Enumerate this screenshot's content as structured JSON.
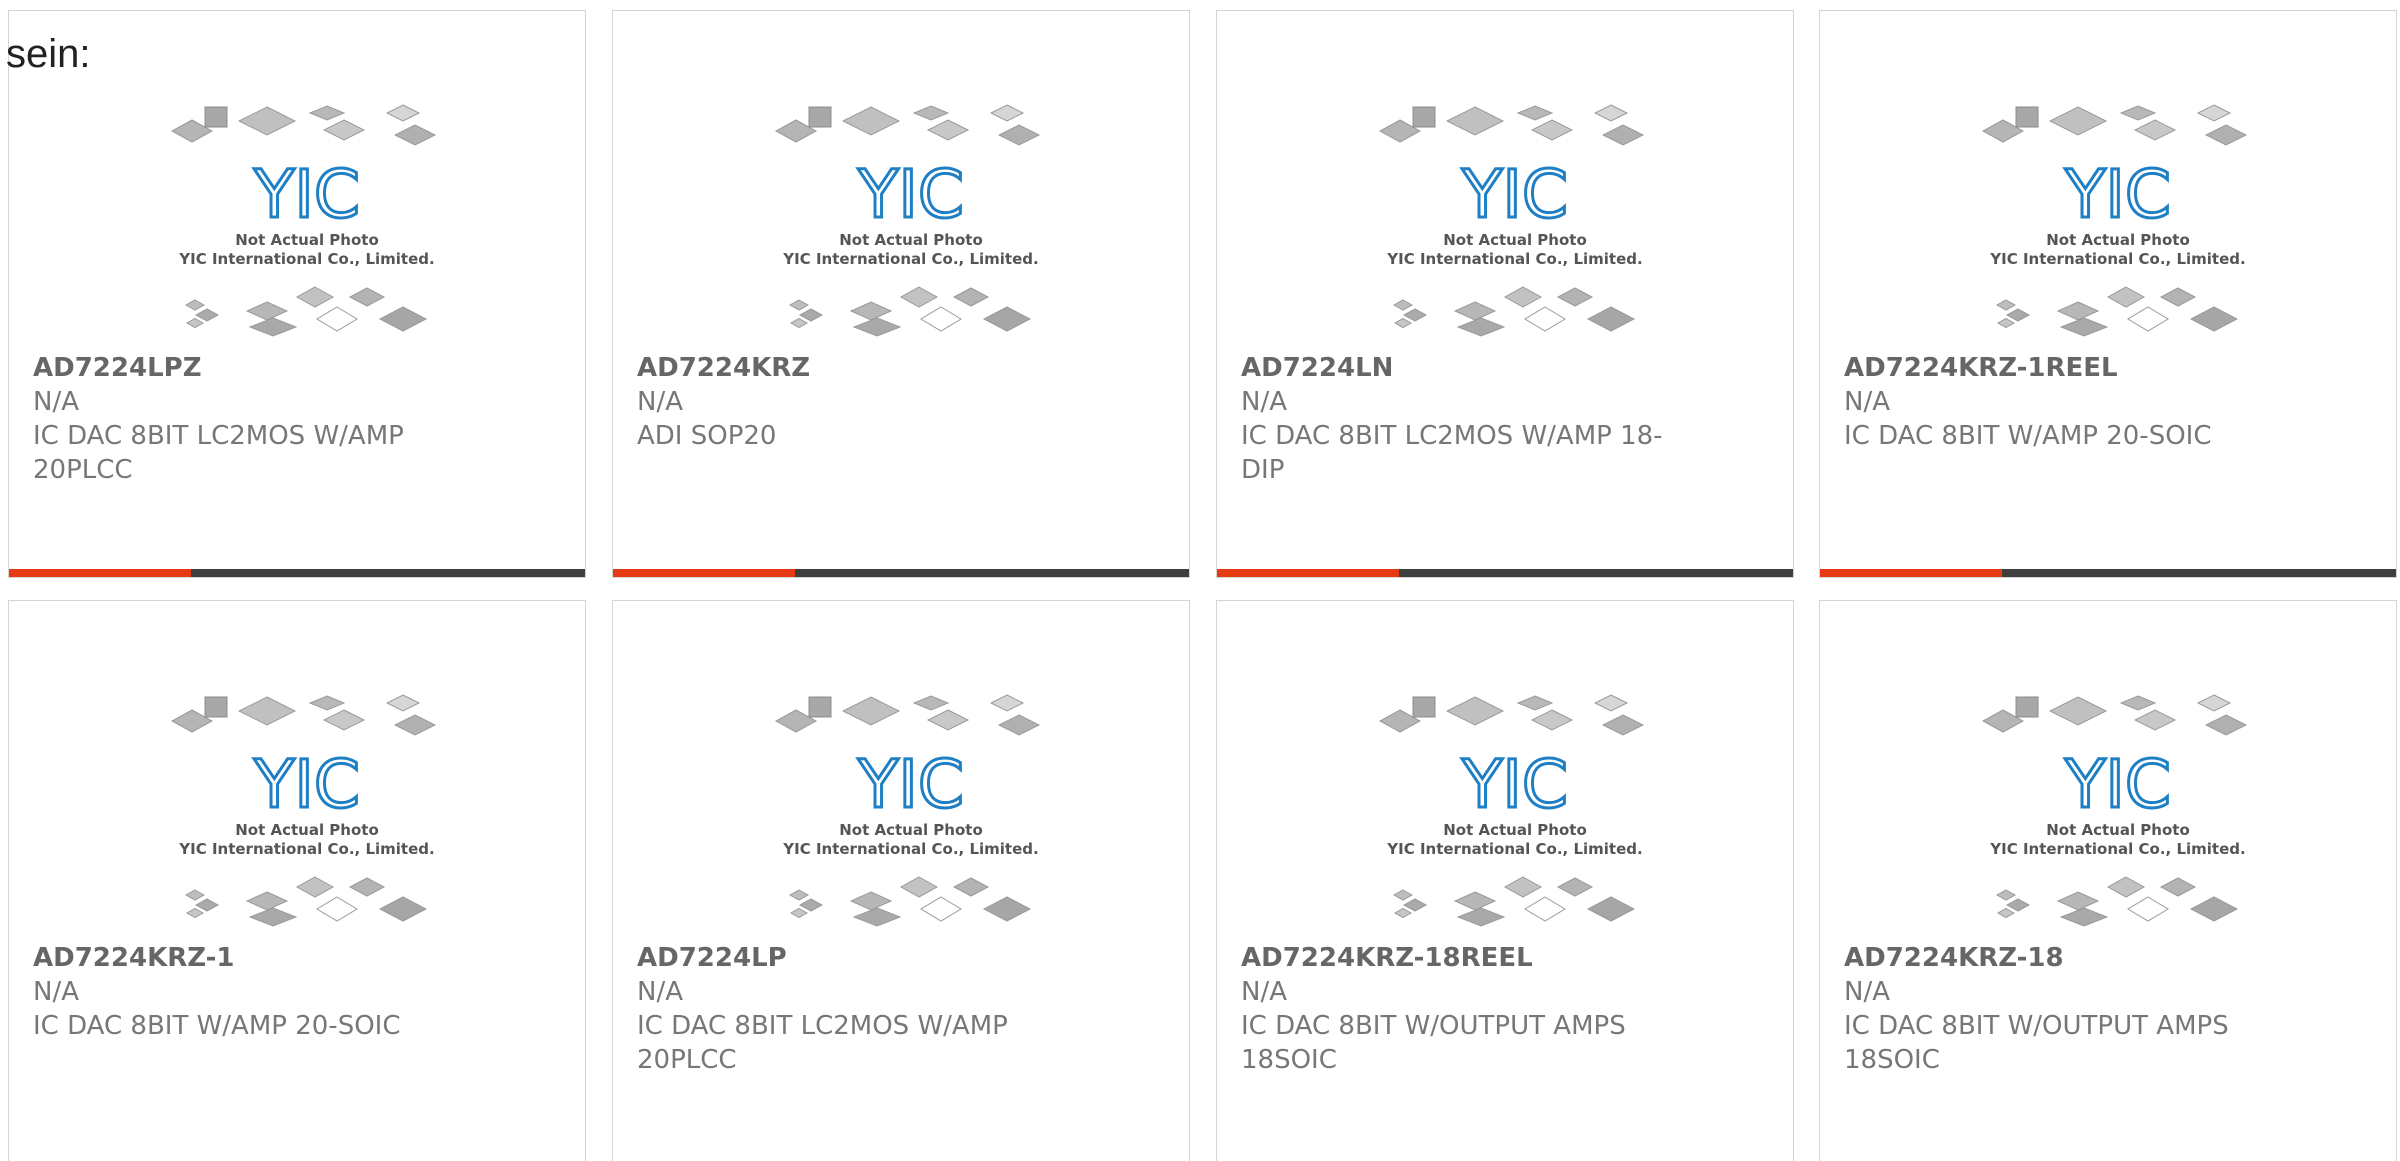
{
  "intro_text": "sein:",
  "placeholder_image": {
    "logo_text": "YIC",
    "line1": "Not Actual Photo",
    "line2": "YIC International Co., Limited."
  },
  "colors": {
    "accent": "#e53a12",
    "bar": "#3e3e3e",
    "logo_blue": "#1e7fc4"
  },
  "products": [
    {
      "part": "AD7224LPZ",
      "manufacturer": "N/A",
      "description": "IC DAC 8BIT LC2MOS W/AMP 20PLCC"
    },
    {
      "part": "AD7224KRZ",
      "manufacturer": "N/A",
      "description": "ADI SOP20"
    },
    {
      "part": "AD7224LN",
      "manufacturer": "N/A",
      "description": "IC DAC 8BIT LC2MOS W/AMP 18-DIP"
    },
    {
      "part": "AD7224KRZ-1REEL",
      "manufacturer": "N/A",
      "description": "IC DAC 8BIT W/AMP 20-SOIC"
    },
    {
      "part": "AD7224KRZ-1",
      "manufacturer": "N/A",
      "description": "IC DAC 8BIT W/AMP 20-SOIC"
    },
    {
      "part": "AD7224LP",
      "manufacturer": "N/A",
      "description": "IC DAC 8BIT LC2MOS W/AMP 20PLCC"
    },
    {
      "part": "AD7224KRZ-18REEL",
      "manufacturer": "N/A",
      "description": "IC DAC 8BIT W/OUTPUT AMPS 18SOIC"
    },
    {
      "part": "AD7224KRZ-18",
      "manufacturer": "N/A",
      "description": "IC DAC 8BIT W/OUTPUT AMPS 18SOIC"
    }
  ]
}
